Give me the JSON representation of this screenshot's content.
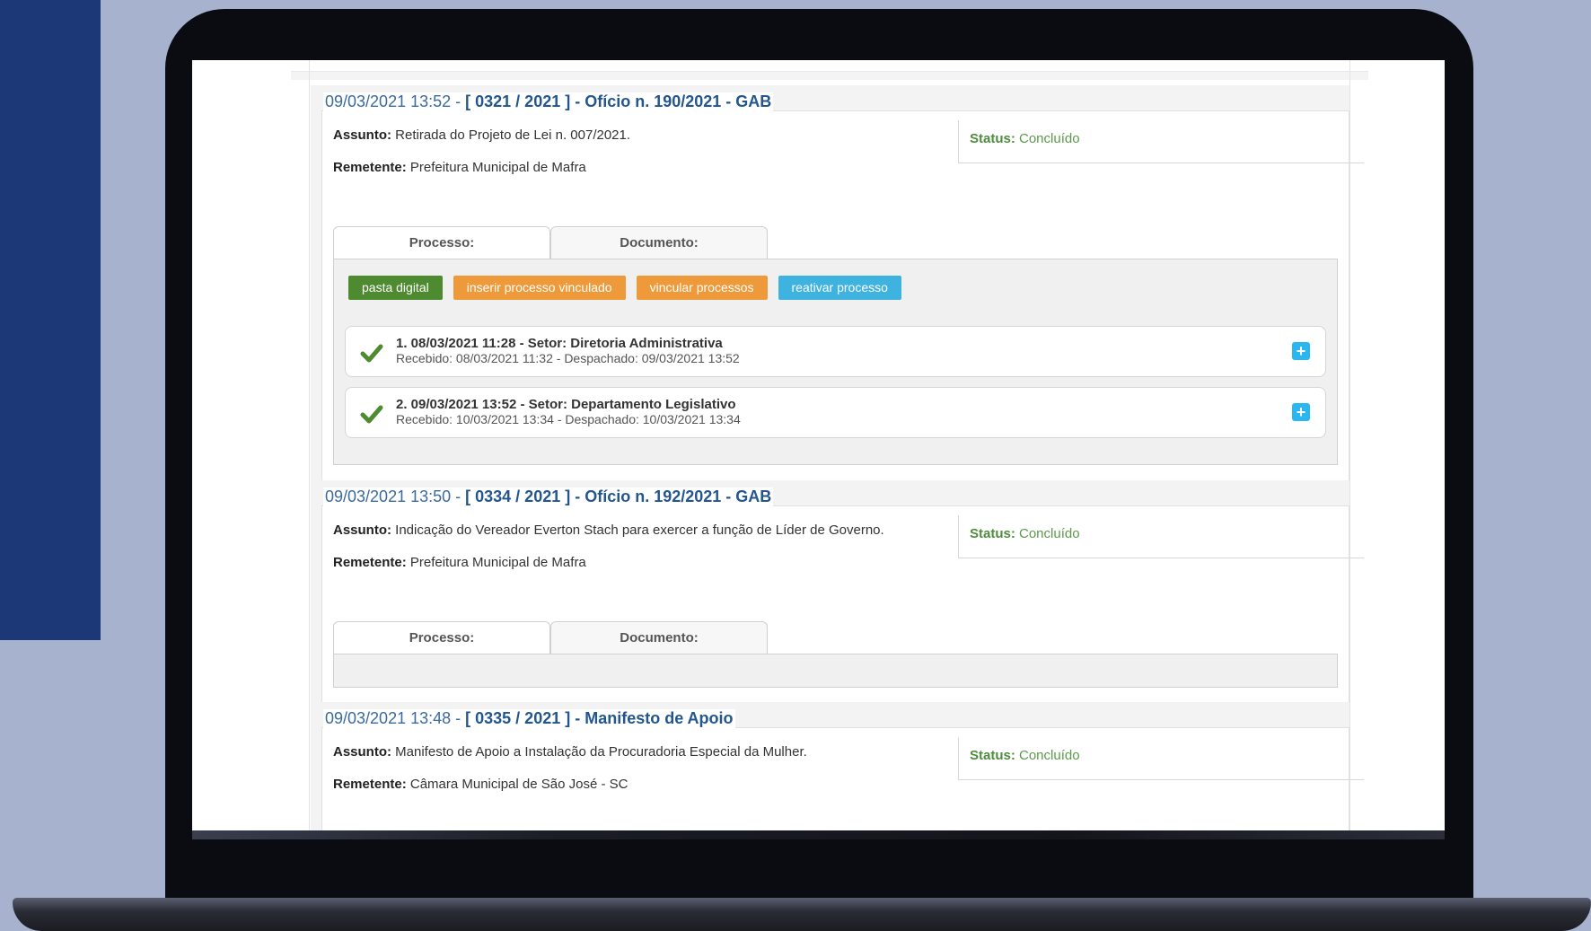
{
  "entries": [
    {
      "timestamp": "09/03/2021 13:52 - ",
      "reference": "[ 0321 / 2021 ] - Ofício n. 190/2021 - GAB",
      "assunto_label": "Assunto:",
      "assunto": " Retirada do Projeto de Lei n. 007/2021.",
      "remetente_label": "Remetente:",
      "remetente": " Prefeitura Municipal de Mafra",
      "status_label": "Status:",
      "status": " Concluído",
      "tabs": [
        "Processo:",
        "Documento:"
      ],
      "buttons": [
        "pasta digital",
        "inserir processo vinculado",
        "vincular processos",
        "reativar processo"
      ],
      "steps": [
        {
          "title": "1. 08/03/2021 11:28 - Setor: Diretoria Administrativa",
          "detail": "Recebido: 08/03/2021 11:32 - Despachado: 09/03/2021 13:52"
        },
        {
          "title": "2. 09/03/2021 13:52 - Setor: Departamento Legislativo",
          "detail": "Recebido: 10/03/2021 13:34 - Despachado: 10/03/2021 13:34"
        }
      ]
    },
    {
      "timestamp": "09/03/2021 13:50 - ",
      "reference": "[ 0334 / 2021 ] - Ofício n. 192/2021 - GAB",
      "assunto_label": "Assunto:",
      "assunto": " Indicação do Vereador Everton Stach para exercer a função de Líder de Governo.",
      "remetente_label": "Remetente:",
      "remetente": " Prefeitura Municipal de Mafra",
      "status_label": "Status:",
      "status": " Concluído",
      "tabs": [
        "Processo:",
        "Documento:"
      ]
    },
    {
      "timestamp": "09/03/2021 13:48 - ",
      "reference": "[ 0335 / 2021 ] - Manifesto de Apoio",
      "assunto_label": "Assunto:",
      "assunto": " Manifesto de Apoio a Instalação da Procuradoria Especial da Mulher.",
      "remetente_label": "Remetente:",
      "remetente": " Câmara Municipal de São José - SC",
      "status_label": "Status:",
      "status": " Concluído"
    }
  ],
  "colors": {
    "background": "#a6b2ce",
    "side_band": "#1c3877",
    "title_blue": "#23568f",
    "status_green": "#4f8c3e",
    "btn_green": "#4e8a2f",
    "btn_orange": "#ef9a3a",
    "btn_blue": "#3fb3df",
    "plus_blue": "#2ab6ee"
  },
  "icons": {
    "check": "check-icon",
    "expand": "plus-icon"
  }
}
